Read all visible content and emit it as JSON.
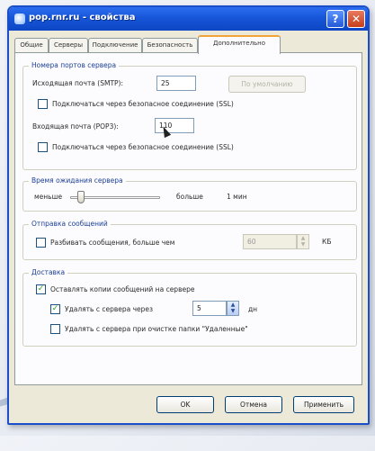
{
  "window": {
    "title": "pop.rnr.ru - свойства",
    "help": "?",
    "close": "✕"
  },
  "tabs": [
    "Общие",
    "Серверы",
    "Подключение",
    "Безопасность",
    "Дополнительно"
  ],
  "server_ports": {
    "label": "Номера портов сервера",
    "smtp_label": "Исходящая почта (SMTP):",
    "smtp_value": "25",
    "defaults_button": "По умолчанию",
    "smtp_ssl_label": "Подключаться через безопасное соединение (SSL)",
    "pop3_label": "Входящая почта (POP3):",
    "pop3_value": "110",
    "pop3_ssl_label": "Подключаться через безопасное соединение (SSL)"
  },
  "timeout": {
    "label": "Время ожидания сервера",
    "less": "меньше",
    "more": "больше",
    "value": "1 мин"
  },
  "sending": {
    "label": "Отправка сообщений",
    "split_label": "Разбивать сообщения, больше чем",
    "split_value": "60",
    "unit": "КБ"
  },
  "delivery": {
    "label": "Доставка",
    "leave_copies_label": "Оставлять копии сообщений на сервере",
    "remove_after_label": "Удалять с сервера через",
    "remove_after_value": "5",
    "days_unit": "дн",
    "remove_deleted_label": "Удалять с сервера при очистке папки \"Удаленные\""
  },
  "buttons": {
    "ok": "OK",
    "cancel": "Отмена",
    "apply": "Применить"
  }
}
